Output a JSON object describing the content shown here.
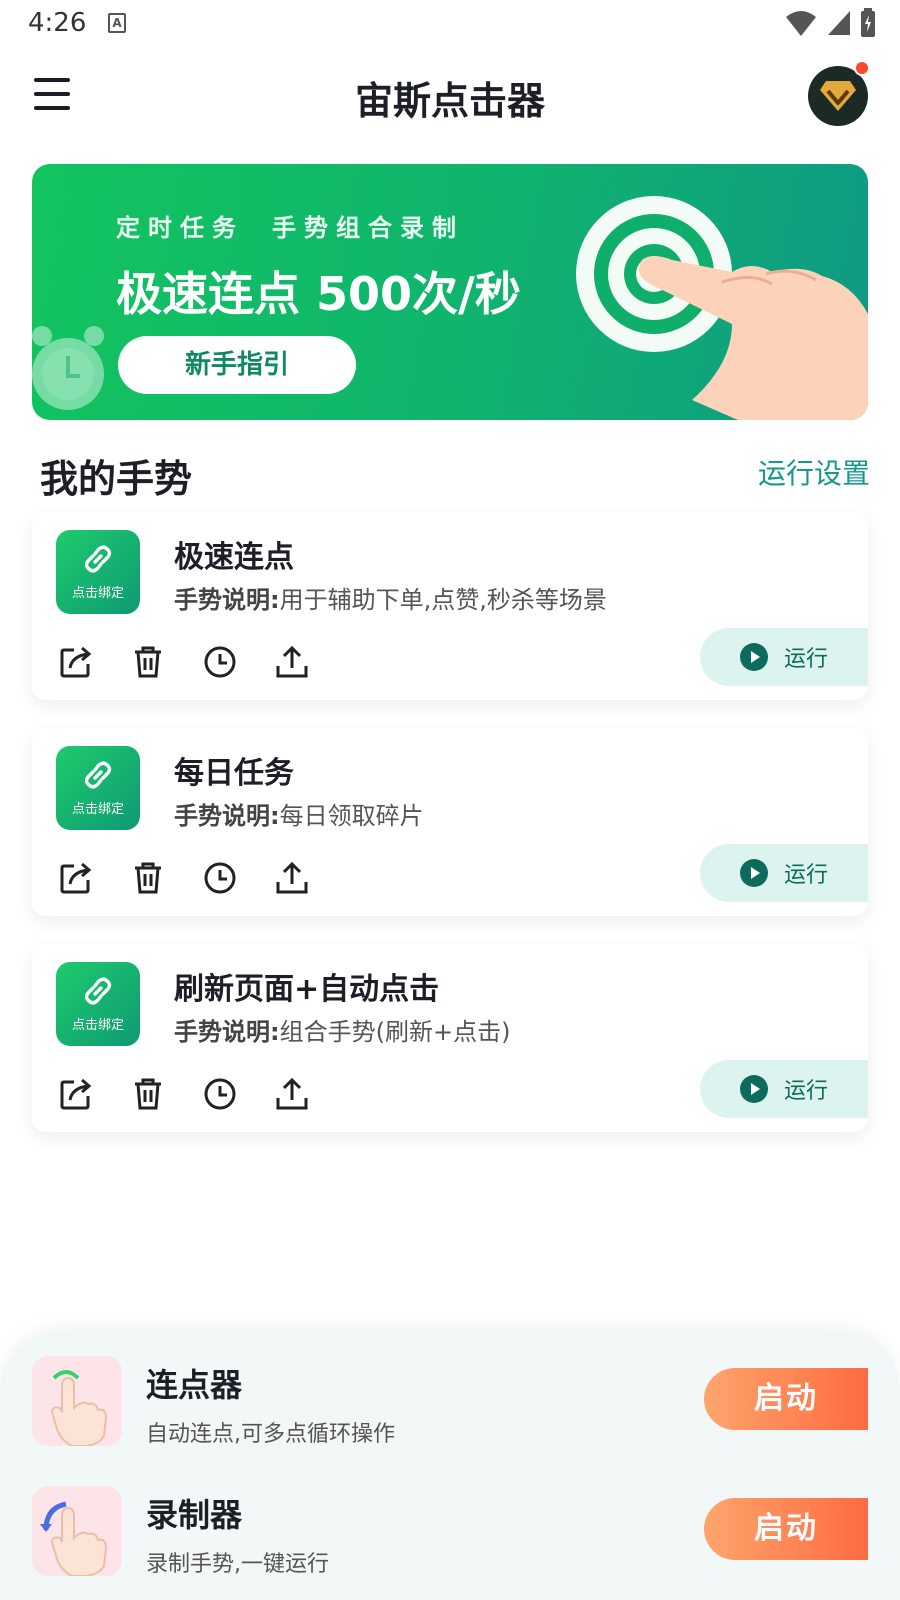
{
  "status_bar": {
    "time": "4:26",
    "notification_letter": "A"
  },
  "header": {
    "title": "宙斯点击器"
  },
  "banner": {
    "subtitle_left": "定时任务",
    "subtitle_right": "手势组合录制",
    "title": "极速连点 500次/秒",
    "button_label": "新手指引"
  },
  "section": {
    "title": "我的手势",
    "link": "运行设置"
  },
  "gestures": [
    {
      "logo_label": "点击绑定",
      "title": "极速连点",
      "desc_label": "手势说明:",
      "desc": "用于辅助下单,点赞,秒杀等场景",
      "run_label": "运行"
    },
    {
      "logo_label": "点击绑定",
      "title": "每日任务",
      "desc_label": "手势说明:",
      "desc": "每日领取碎片",
      "run_label": "运行"
    },
    {
      "logo_label": "点击绑定",
      "title": "刷新页面+自动点击",
      "desc_label": "手势说明:",
      "desc": "组合手势(刷新+点击)",
      "run_label": "运行"
    }
  ],
  "tools": [
    {
      "name": "连点器",
      "desc": "自动连点,可多点循环操作",
      "button": "启动"
    },
    {
      "name": "录制器",
      "desc": "录制手势,一键运行",
      "button": "启动"
    }
  ],
  "colors": {
    "accent": "#14998a",
    "banner_green": "#12c45f",
    "start_orange": "#ff6b42",
    "run_bg": "#dcf3ef"
  }
}
